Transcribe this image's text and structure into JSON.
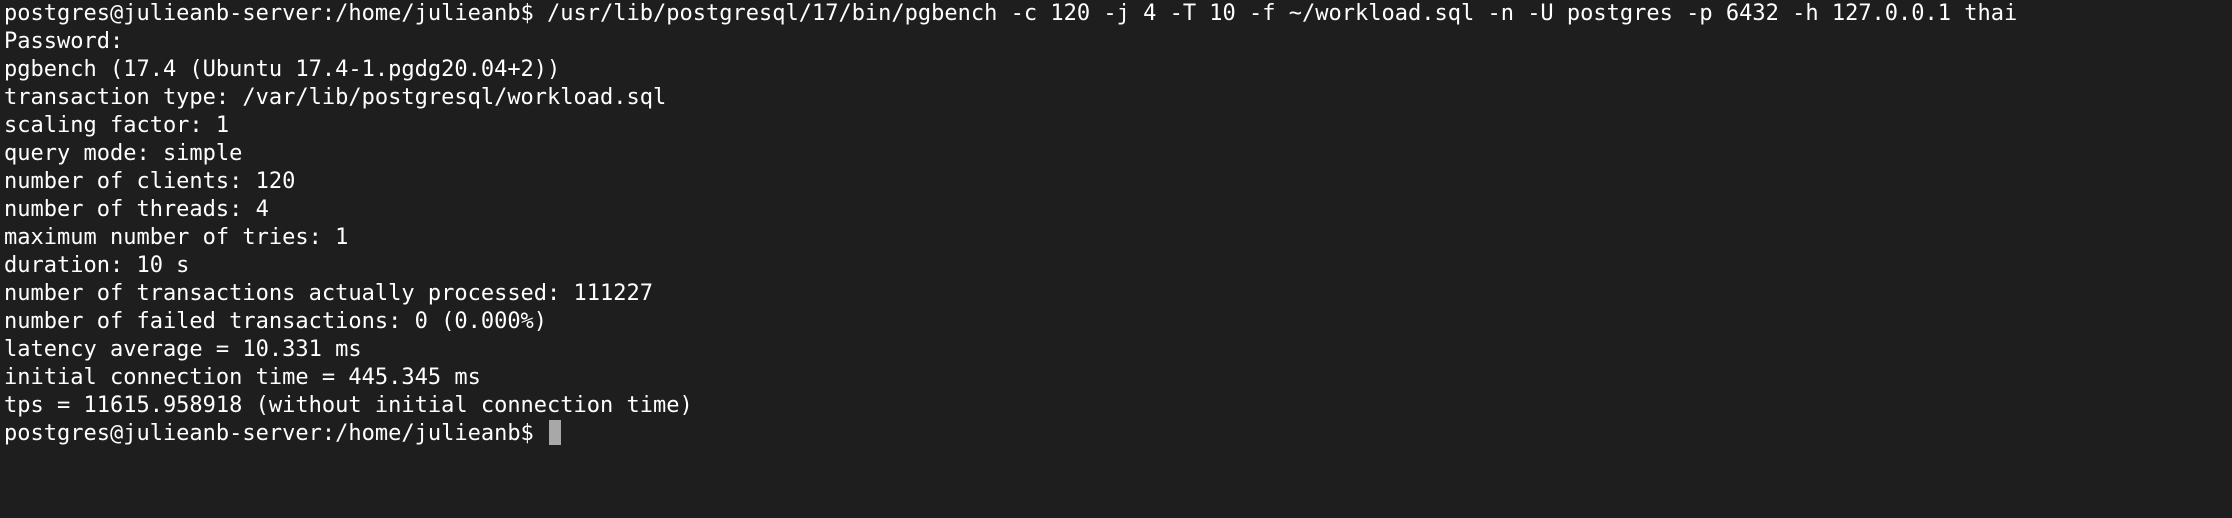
{
  "terminal": {
    "lines": [
      "postgres@julieanb-server:/home/julieanb$ /usr/lib/postgresql/17/bin/pgbench -c 120 -j 4 -T 10 -f ~/workload.sql -n -U postgres -p 6432 -h 127.0.0.1 thai",
      "Password:",
      "pgbench (17.4 (Ubuntu 17.4-1.pgdg20.04+2))",
      "transaction type: /var/lib/postgresql/workload.sql",
      "scaling factor: 1",
      "query mode: simple",
      "number of clients: 120",
      "number of threads: 4",
      "maximum number of tries: 1",
      "duration: 10 s",
      "number of transactions actually processed: 111227",
      "number of failed transactions: 0 (0.000%)",
      "latency average = 10.331 ms",
      "initial connection time = 445.345 ms",
      "tps = 11615.958918 (without initial connection time)"
    ],
    "prompt": "postgres@julieanb-server:/home/julieanb$ ",
    "colors": {
      "background": "#1e1e1e",
      "foreground": "#ffffff",
      "cursor": "#a8a8a8"
    }
  }
}
